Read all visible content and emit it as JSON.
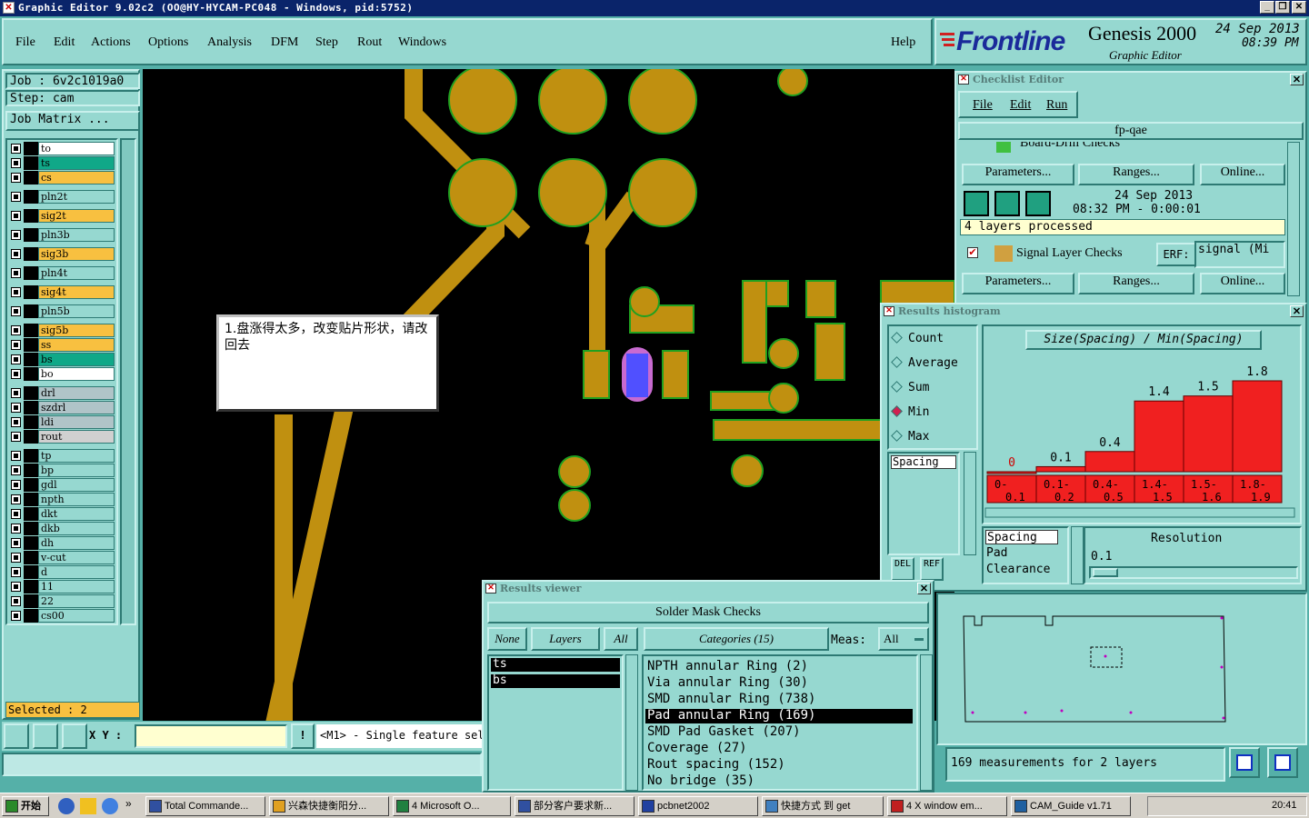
{
  "titlebar": {
    "title": "Graphic Editor 9.02c2 (OO@HY-HYCAM-PC048 - Windows, pid:5752)"
  },
  "menu": {
    "items": [
      "File",
      "Edit",
      "Actions",
      "Options",
      "Analysis",
      "DFM",
      "Step",
      "Rout",
      "Windows"
    ],
    "help": "Help"
  },
  "brand": {
    "logo": "Frontline",
    "product": "Genesis 2000",
    "subtitle": "Graphic Editor",
    "date": "24 Sep 2013",
    "time": "08:39 PM"
  },
  "job": {
    "job": "Job : 6v2c1019a0",
    "step": "Step: cam",
    "matrix_button": "Job Matrix ..."
  },
  "layers": [
    {
      "name": "to",
      "color": "#ffffff"
    },
    {
      "name": "ts",
      "color": "#10a888"
    },
    {
      "name": "cs",
      "color": "#f8c040"
    },
    {
      "name": "pln2t",
      "color": "#96d8d0"
    },
    {
      "name": "sig2t",
      "color": "#f8c040"
    },
    {
      "name": "pln3b",
      "color": "#96d8d0"
    },
    {
      "name": "sig3b",
      "color": "#f8c040"
    },
    {
      "name": "pln4t",
      "color": "#96d8d0"
    },
    {
      "name": "sig4t",
      "color": "#f8c040"
    },
    {
      "name": "pln5b",
      "color": "#96d8d0"
    },
    {
      "name": "sig5b",
      "color": "#f8c040"
    },
    {
      "name": "ss",
      "color": "#f8c040"
    },
    {
      "name": "bs",
      "color": "#10a888"
    },
    {
      "name": "bo",
      "color": "#ffffff"
    },
    {
      "name": "drl",
      "color": "#b0c4c8"
    },
    {
      "name": "szdrl",
      "color": "#b0c4c8"
    },
    {
      "name": "ldi",
      "color": "#b0c4c8"
    },
    {
      "name": "rout",
      "color": "#d0d0d0"
    },
    {
      "name": "tp",
      "color": "#96d8d0"
    },
    {
      "name": "bp",
      "color": "#96d8d0"
    },
    {
      "name": "gdl",
      "color": "#96d8d0"
    },
    {
      "name": "npth",
      "color": "#96d8d0"
    },
    {
      "name": "dkt",
      "color": "#96d8d0"
    },
    {
      "name": "dkb",
      "color": "#96d8d0"
    },
    {
      "name": "dh",
      "color": "#96d8d0"
    },
    {
      "name": "v-cut",
      "color": "#96d8d0"
    },
    {
      "name": "d",
      "color": "#96d8d0"
    },
    {
      "name": "11",
      "color": "#96d8d0"
    },
    {
      "name": "22",
      "color": "#96d8d0"
    },
    {
      "name": "cs00",
      "color": "#96d8d0"
    }
  ],
  "selected": "Selected : 2",
  "xy_label": "X Y :",
  "mouse_hint": "<M1> - Single feature sele",
  "note": {
    "text": "1.盘涨得太多，改变贴片形状，请改回去"
  },
  "checklist": {
    "title": "Checklist Editor",
    "menu": [
      "File",
      "Edit",
      "Run"
    ],
    "name": "fp-qae",
    "row1_label": "Board-Drill Checks",
    "erf": "ERF:",
    "buttons": [
      "Parameters...",
      "Ranges...",
      "Online..."
    ],
    "date": "24 Sep 2013",
    "time": "08:32 PM - 0:00:01",
    "status": "4 layers processed",
    "row2_label": "Signal Layer Checks",
    "row2_erf_value": "signal (Mi"
  },
  "histogram": {
    "title": "Results histogram",
    "options": [
      "Count",
      "Average",
      "Sum",
      "Min",
      "Max"
    ],
    "selected_option": "Min",
    "chart_title": "Size(Spacing) / Min(Spacing)",
    "list_item": "Spacing",
    "del_label": "DEL",
    "ref_label": "REF",
    "types": [
      "Spacing",
      "Pad",
      "Clearance"
    ],
    "resolution_label": "Resolution",
    "resolution_value": "0.1"
  },
  "chart_data": {
    "type": "bar",
    "title": "Size(Spacing) / Min(Spacing)",
    "categories": [
      "0-0.1",
      "0.1-0.2",
      "0.4-0.5",
      "1.4-1.5",
      "1.5-1.6",
      "1.8-1.9"
    ],
    "values": [
      0,
      0.1,
      0.4,
      1.4,
      1.5,
      1.8
    ],
    "value_labels": [
      "0",
      "0.1",
      "0.4",
      "1.4",
      "1.5",
      "1.8"
    ],
    "bin_labels": [
      [
        "0-",
        "0.1"
      ],
      [
        "0.1-",
        "0.2"
      ],
      [
        "0.4-",
        "0.5"
      ],
      [
        "1.4-",
        "1.5"
      ],
      [
        "1.5-",
        "1.6"
      ],
      [
        "1.8-",
        "1.9"
      ]
    ],
    "colors": {
      "bar": "#f02020",
      "zero_label": "#d00000"
    }
  },
  "results_viewer": {
    "title": "Results viewer",
    "header": "Solder Mask Checks",
    "tabs": {
      "none": "None",
      "layers": "Layers",
      "all": "All"
    },
    "layers": [
      "ts",
      "bs"
    ],
    "categories_label": "Categories (15)",
    "meas_label": "Meas:",
    "meas_value": "All",
    "categories": [
      "NPTH annular Ring (2)",
      "Via annular Ring (30)",
      "SMD annular Ring (738)",
      "Pad annular Ring (169)",
      "SMD Pad Gasket (207)",
      "Coverage (27)",
      "Rout spacing (152)",
      "No bridge (35)"
    ],
    "selected_category": "Pad annular Ring (169)",
    "measurements": "169 measurements for 2 layers"
  },
  "taskbar": {
    "start": "开始",
    "tasks": [
      "Total Commande...",
      "兴森快捷衡阳分...",
      "4 Microsoft O...",
      "部分客户要求新...",
      "pcbnet2002",
      "快捷方式 到 get",
      "4 X window em...",
      "CAM_Guide v1.71"
    ],
    "clock": "20:41"
  },
  "colors": {
    "panel": "#96d8d0",
    "copper": "#c09010",
    "pad_edge": "#20a020",
    "selection": "#5050ff"
  }
}
